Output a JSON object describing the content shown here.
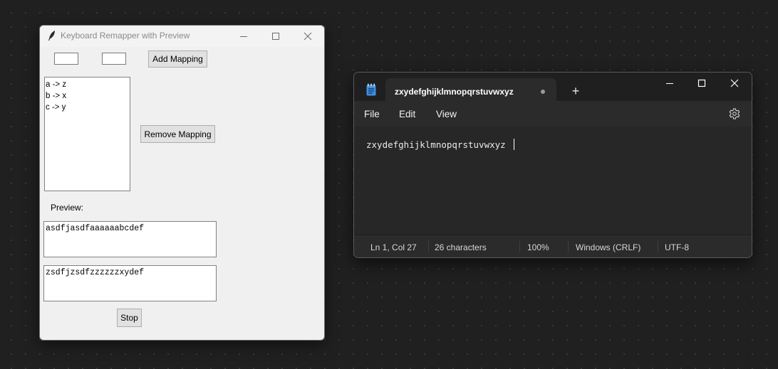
{
  "tk_window": {
    "title": "Keyboard Remapper with Preview",
    "from_key_value": "",
    "to_key_value": "",
    "add_mapping_label": "Add Mapping",
    "remove_mapping_label": "Remove Mapping",
    "mappings": [
      "a -> z",
      "b -> x",
      "c -> y"
    ],
    "preview_label": "Preview:",
    "input_text": "asdfjasdfaaaaaabcdef",
    "output_text": "zsdfjzsdfzzzzzzxydef",
    "stop_label": "Stop"
  },
  "notepad": {
    "tab_title": "zxydefghijklmnopqrstuvwxyz",
    "unsaved_indicator": true,
    "menu": [
      "File",
      "Edit",
      "View"
    ],
    "content": "zxydefghijklmnopqrstuvwxyz",
    "status": {
      "position": "Ln 1, Col 27",
      "characters": "26 characters",
      "zoom": "100%",
      "line_endings": "Windows (CRLF)",
      "encoding": "UTF-8"
    }
  },
  "colors": {
    "desktop_bg": "#202020",
    "tk_bg": "#f0f0f0",
    "notepad_bg": "#272727",
    "notepad_icon": "#5aa9ff"
  },
  "icons": [
    "feather-icon",
    "minimize-icon",
    "maximize-icon",
    "close-icon",
    "notepad-icon",
    "unsaved-dot-icon",
    "plus-icon",
    "gear-icon"
  ]
}
